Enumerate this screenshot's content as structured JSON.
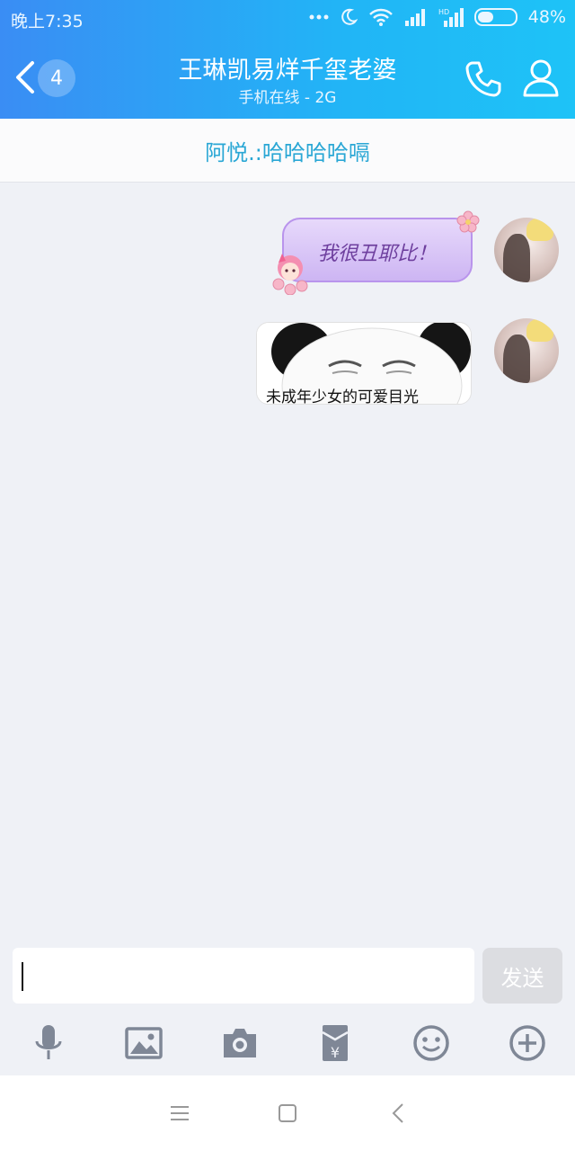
{
  "status_bar": {
    "time": "晚上7:35",
    "battery_text": "48%",
    "battery_level": 0.48
  },
  "header": {
    "unread_count": "4",
    "title": "王琳凯易烊千玺老婆",
    "subtitle": "手机在线 - 2G"
  },
  "pinned_message": "阿悦.:哈哈哈哈嗝",
  "messages": [
    {
      "type": "sticker-text",
      "text": "我很丑耶比！"
    },
    {
      "type": "image",
      "caption": "未成年少女的可爱目光"
    }
  ],
  "input": {
    "value": "",
    "send_label": "发送"
  },
  "toolbar_icons": [
    "microphone-icon",
    "image-icon",
    "camera-icon",
    "red-packet-icon",
    "emoji-icon",
    "plus-icon"
  ],
  "colors": {
    "header_gradient_start": "#3a8df4",
    "header_gradient_end": "#1ec3f7",
    "pinned_text": "#2aa7d5",
    "background": "#eff1f6"
  }
}
